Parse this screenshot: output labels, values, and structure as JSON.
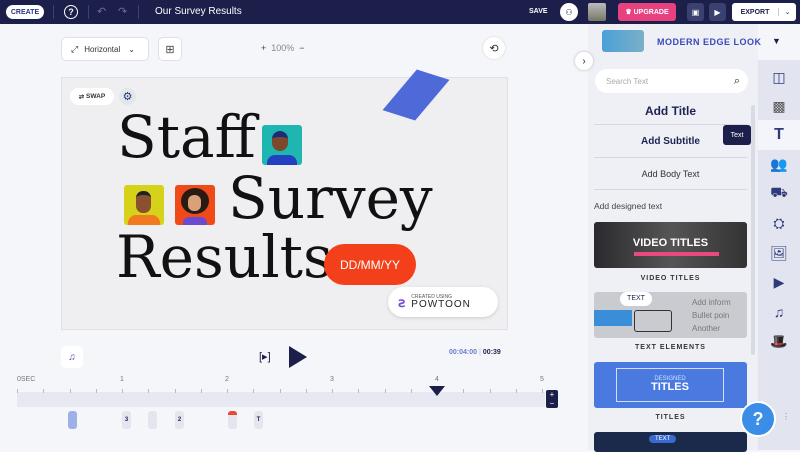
{
  "topbar": {
    "create_label": "CREATE",
    "title": "Our Survey Results",
    "save_label": "SAVE",
    "upgrade_label": "UPGRADE",
    "export_label": "EXPORT"
  },
  "toolbar": {
    "orientation": "Horizontal",
    "zoom": "100%"
  },
  "canvas": {
    "swap_label": "SWAP",
    "line1": "Staff",
    "line2": "Survey",
    "line3": "Results",
    "date_badge": "DD/MM/YY",
    "watermark_small": "CREATED USING",
    "watermark_brand": "POWTOON"
  },
  "player": {
    "current_time": "00:04:00",
    "total_time": "00:39"
  },
  "timeline": {
    "labels": [
      "0SEC",
      "1",
      "2",
      "3",
      "4",
      "5"
    ],
    "playhead_sec": 4,
    "clips": [
      "",
      "3",
      "",
      "2",
      "",
      "T"
    ]
  },
  "panel": {
    "style_name": "MODERN EDGE LOOK",
    "search_placeholder": "Search Text",
    "add_title": "Add Title",
    "add_subtitle": "Add Subtitle",
    "add_body": "Add Body Text",
    "designed_heading": "Add designed text",
    "tooltip": "Text",
    "cards": [
      {
        "label": "VIDEO TITLES",
        "preview": "VIDEO TITLES"
      },
      {
        "label": "TEXT ELEMENTS",
        "preview": "TEXT",
        "bullets": [
          "Add inform",
          "Bullet poin",
          "Another"
        ]
      },
      {
        "label": "TITLES",
        "preview_top": "DESIGNED",
        "preview": "TITLES"
      }
    ],
    "card4_preview": "TEXT"
  },
  "help_label": "?",
  "colors": {
    "navy": "#1b1f4a",
    "accent": "#4a6bdc",
    "upgrade": "#e8417f",
    "date": "#f4401a"
  }
}
